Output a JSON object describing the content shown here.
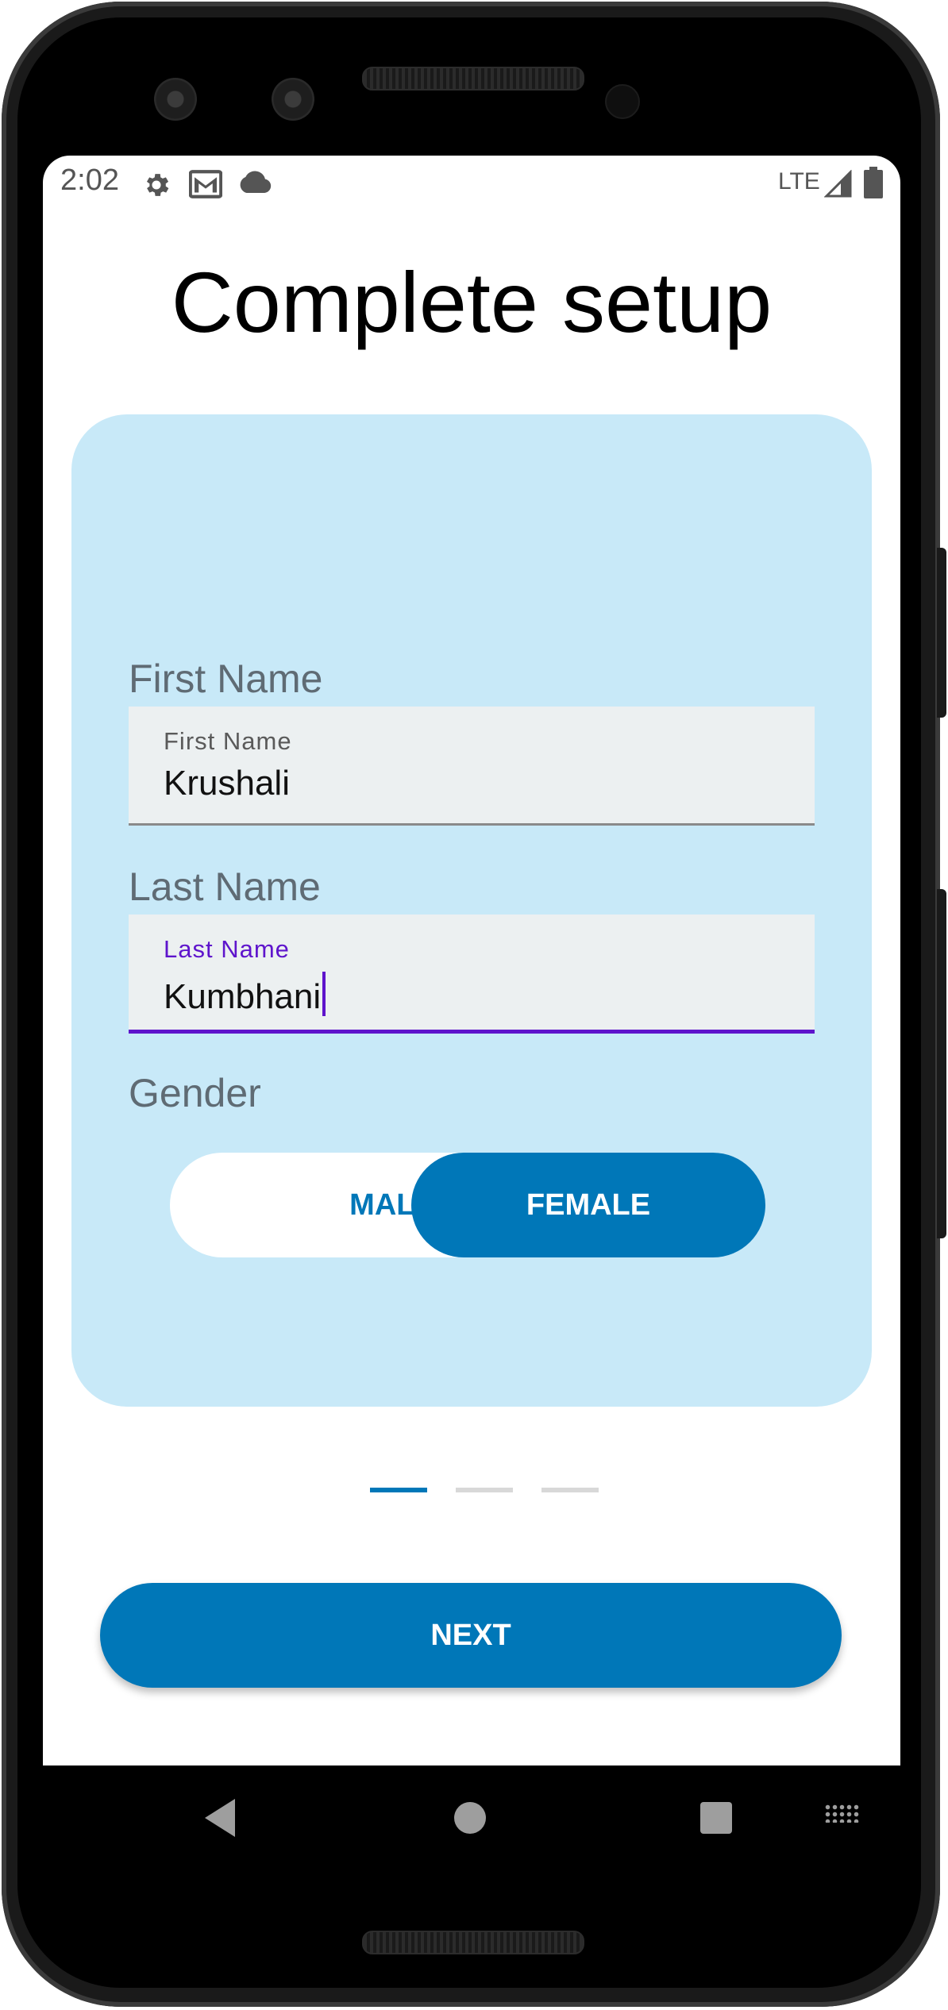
{
  "status_bar": {
    "time": "2:02",
    "icons": [
      "gear-icon",
      "gmail-icon",
      "cloud-icon"
    ],
    "network": "LTE",
    "right_icons": [
      "signal-icon",
      "battery-icon"
    ]
  },
  "page": {
    "title": "Complete setup"
  },
  "form": {
    "first_name": {
      "heading": "First Name",
      "label": "First Name",
      "value": "Krushali"
    },
    "last_name": {
      "heading": "Last Name",
      "label": "Last Name",
      "value": "Kumbhani"
    },
    "gender": {
      "heading": "Gender",
      "options": [
        "MALE",
        "FEMALE"
      ],
      "selected": "FEMALE"
    }
  },
  "pager": {
    "total": 3,
    "current": 1
  },
  "actions": {
    "next_label": "NEXT"
  },
  "colors": {
    "accent": "#0077b8",
    "card_background": "#c8e9f8",
    "focus": "#5e14cc",
    "field_background": "#ecf0f1",
    "heading_text": "#5f6b74"
  },
  "nav_bar": {
    "icons": [
      "back-icon",
      "home-icon",
      "recents-icon",
      "keyboard-icon"
    ]
  }
}
